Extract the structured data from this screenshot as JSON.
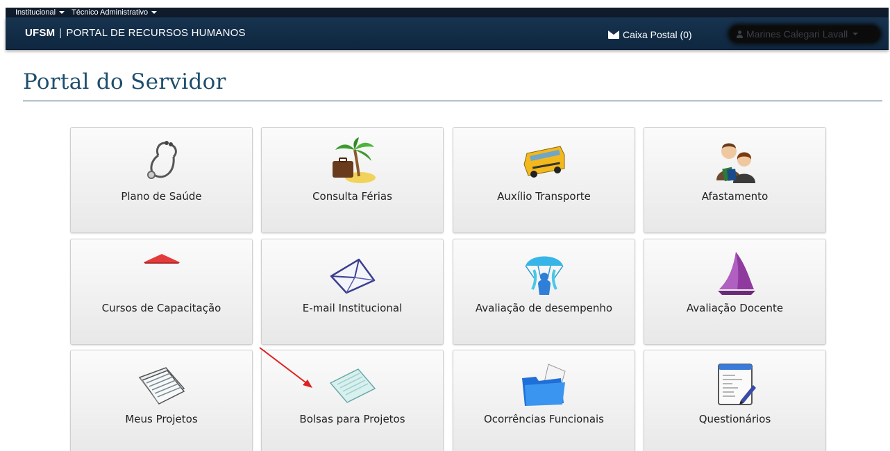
{
  "top_menu": {
    "items": [
      {
        "label": "Institucional"
      },
      {
        "label": "Técnico Administrativo"
      }
    ]
  },
  "navbar": {
    "brand_bold": "UFSM",
    "brand_separator": "|",
    "brand_text": "PORTAL DE RECURSOS HUMANOS",
    "mail_label": "Caixa Postal (0)",
    "user_name": "Marines Calegari Lavall"
  },
  "page": {
    "title": "Portal do Servidor"
  },
  "tiles": [
    {
      "label": "Plano de Saúde",
      "icon": "stethoscope-icon"
    },
    {
      "label": "Consulta Férias",
      "icon": "palm-tree-suitcase-icon"
    },
    {
      "label": "Auxílio Transporte",
      "icon": "school-bus-icon"
    },
    {
      "label": "Afastamento",
      "icon": "people-icon"
    },
    {
      "label": "Cursos de Capacitação",
      "icon": "red-triangle-icon"
    },
    {
      "label": "E-mail Institucional",
      "icon": "envelope-icon"
    },
    {
      "label": "Avaliação de desempenho",
      "icon": "parachute-person-icon"
    },
    {
      "label": "Avaliação Docente",
      "icon": "sail-icon"
    },
    {
      "label": "Meus Projetos",
      "icon": "ledger-papers-icon"
    },
    {
      "label": "Bolsas para Projetos",
      "icon": "notepad-icon"
    },
    {
      "label": "Ocorrências Funcionais",
      "icon": "blue-folder-icon"
    },
    {
      "label": "Questionários",
      "icon": "questionnaire-document-icon"
    }
  ],
  "colors": {
    "navbar": "#17334f",
    "title": "#1e4e6d",
    "annotation_arrow": "#e02020"
  }
}
